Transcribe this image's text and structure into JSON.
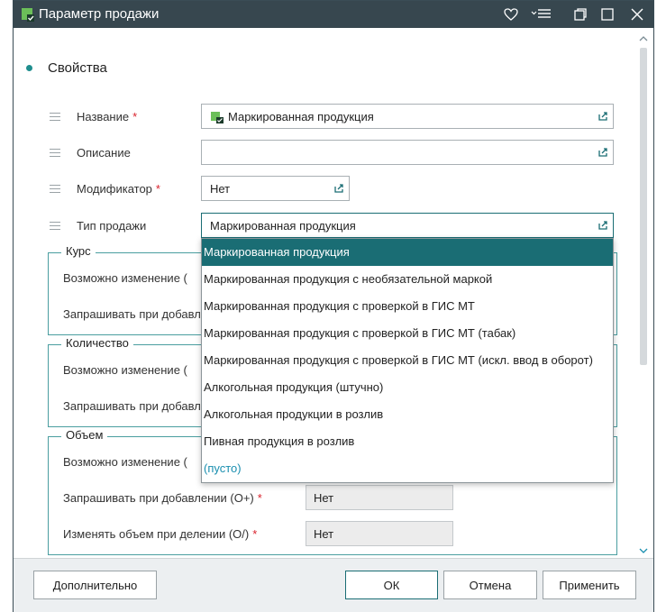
{
  "window": {
    "title": "Параметр продажи",
    "colors": {
      "titlebar": "#37474f",
      "accent": "#1a6d74",
      "required": "#d9232d"
    }
  },
  "section": {
    "title": "Свойства"
  },
  "fields": {
    "name": {
      "label": "Название",
      "value": "Маркированная продукция",
      "required": "*"
    },
    "description": {
      "label": "Описание",
      "value": ""
    },
    "modifier": {
      "label": "Модификатор",
      "value": "Нет",
      "required": "*"
    },
    "sale_type": {
      "label": "Тип продажи",
      "value": "Маркированная продукция"
    }
  },
  "groups": {
    "rate": {
      "legend": "Курс",
      "row1": "Возможно изменение (",
      "row2": "Запрашивать при добавл"
    },
    "quantity": {
      "legend": "Количество",
      "row1": "Возможно изменение (",
      "row2": "Запрашивать при добавл"
    },
    "volume": {
      "legend": "Объем",
      "row1": "Возможно изменение (",
      "row2": {
        "label": "Запрашивать при добавлении (О+)",
        "required": "*",
        "value": "Нет"
      },
      "row3": {
        "label": "Изменять объем при делении (О/)",
        "required": "*",
        "value": "Нет"
      }
    }
  },
  "dropdown": {
    "options": [
      "Маркированная продукция",
      "Маркированная продукция с необязательной маркой",
      "Маркированная продукция с проверкой в ГИС МТ",
      "Маркированная продукция с проверкой в ГИС МТ (табак)",
      "Маркированная продукция с проверкой в ГИС МТ (искл. ввод в оборот)",
      "Алкогольная продукция (штучно)",
      "Алкогольная продукции в розлив",
      "Пивная продукция в розлив",
      "(пусто)"
    ],
    "selected_index": 0
  },
  "footer": {
    "more_label": "Дополнительно",
    "ok_label": "ОК",
    "cancel_label": "Отмена",
    "apply_label": "Применить"
  },
  "icons": {
    "app": "app-document-check-icon",
    "favorite": "heart-icon",
    "menu": "menu-list-icon",
    "restore": "restore-icon",
    "maximize": "maximize-icon",
    "close": "close-icon",
    "field_action": "field-expand-icon",
    "drag": "drag-handle-icon"
  }
}
